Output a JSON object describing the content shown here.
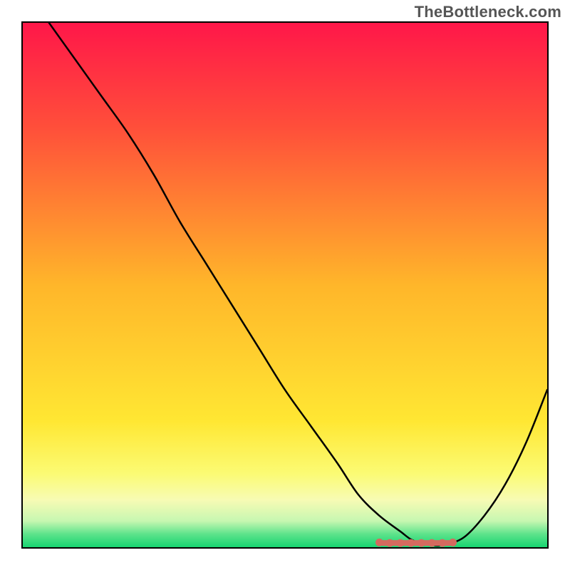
{
  "watermark": "TheBottleneck.com",
  "chart_data": {
    "type": "line",
    "title": "",
    "xlabel": "",
    "ylabel": "",
    "xlim": [
      0,
      100
    ],
    "ylim": [
      0,
      100
    ],
    "gradient": {
      "stops": [
        {
          "offset": 0,
          "color": "#ff1749"
        },
        {
          "offset": 0.2,
          "color": "#ff4f3a"
        },
        {
          "offset": 0.5,
          "color": "#ffb62a"
        },
        {
          "offset": 0.76,
          "color": "#ffe733"
        },
        {
          "offset": 0.86,
          "color": "#fbfb74"
        },
        {
          "offset": 0.91,
          "color": "#f7fbb4"
        },
        {
          "offset": 0.95,
          "color": "#c7f7b1"
        },
        {
          "offset": 0.975,
          "color": "#5de38b"
        },
        {
          "offset": 1.0,
          "color": "#17d471"
        }
      ]
    },
    "series": [
      {
        "name": "curve",
        "x": [
          5,
          10,
          15,
          20,
          25,
          30,
          35,
          40,
          45,
          50,
          55,
          60,
          64,
          68,
          72,
          74,
          76,
          78,
          80,
          84,
          88,
          92,
          96,
          100
        ],
        "values": [
          100,
          93,
          86,
          79,
          71,
          62,
          54,
          46,
          38,
          30,
          23,
          16,
          10,
          6,
          3,
          1.5,
          0.7,
          0.4,
          0.4,
          1.8,
          6,
          12,
          20,
          30
        ]
      }
    ],
    "marker_band": {
      "x_start": 68,
      "x_end": 82,
      "y": 0.8,
      "color": "#d46a5f"
    },
    "markers": [
      {
        "x": 68,
        "y": 0.9
      },
      {
        "x": 70,
        "y": 0.8
      },
      {
        "x": 72,
        "y": 0.8
      },
      {
        "x": 74,
        "y": 0.8
      },
      {
        "x": 76,
        "y": 0.8
      },
      {
        "x": 78,
        "y": 0.8
      },
      {
        "x": 80,
        "y": 0.8
      },
      {
        "x": 82,
        "y": 0.9
      }
    ]
  }
}
